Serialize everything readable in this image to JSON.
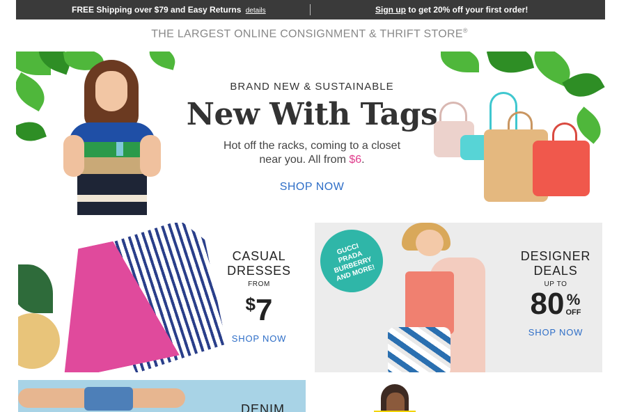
{
  "topbar": {
    "left_text": "FREE Shipping over $79 and Easy Returns",
    "left_link": "details",
    "signup_link": "Sign up",
    "right_text": " to get 20% off your first order!"
  },
  "tagline": {
    "text": "THE LARGEST ONLINE CONSIGNMENT & THRIFT STORE",
    "mark": "®"
  },
  "hero": {
    "kicker": "BRAND NEW & SUSTAINABLE",
    "title": "New With Tags",
    "sub_line1": "Hot off the racks, coming to a closet",
    "sub_line2_prefix": "near you. All from ",
    "price": "$6",
    "sub_line2_suffix": ".",
    "shop_label": "SHOP NOW"
  },
  "tiles": {
    "casual": {
      "line1": "CASUAL",
      "line2": "DRESSES",
      "from": "FROM",
      "price_symbol": "$",
      "price": "7",
      "shop_label": "SHOP NOW"
    },
    "designer": {
      "badge_lines": [
        "GUCCI",
        "PRADA",
        "BURBERRY",
        "AND MORE!"
      ],
      "line1": "DESIGNER",
      "line2": "DEALS",
      "up_to": "UP TO",
      "percent": "80",
      "percent_symbol": "%",
      "off": "OFF",
      "shop_label": "SHOP NOW"
    },
    "denim": {
      "label": "DENIM"
    }
  },
  "colors": {
    "topbar_bg": "#3a3a3a",
    "accent_blue": "#2e6ec7",
    "accent_pink": "#e03c8c",
    "badge_teal": "#2fb6a8"
  },
  "icons": [
    "leaf-decoration",
    "handbag-icon"
  ]
}
